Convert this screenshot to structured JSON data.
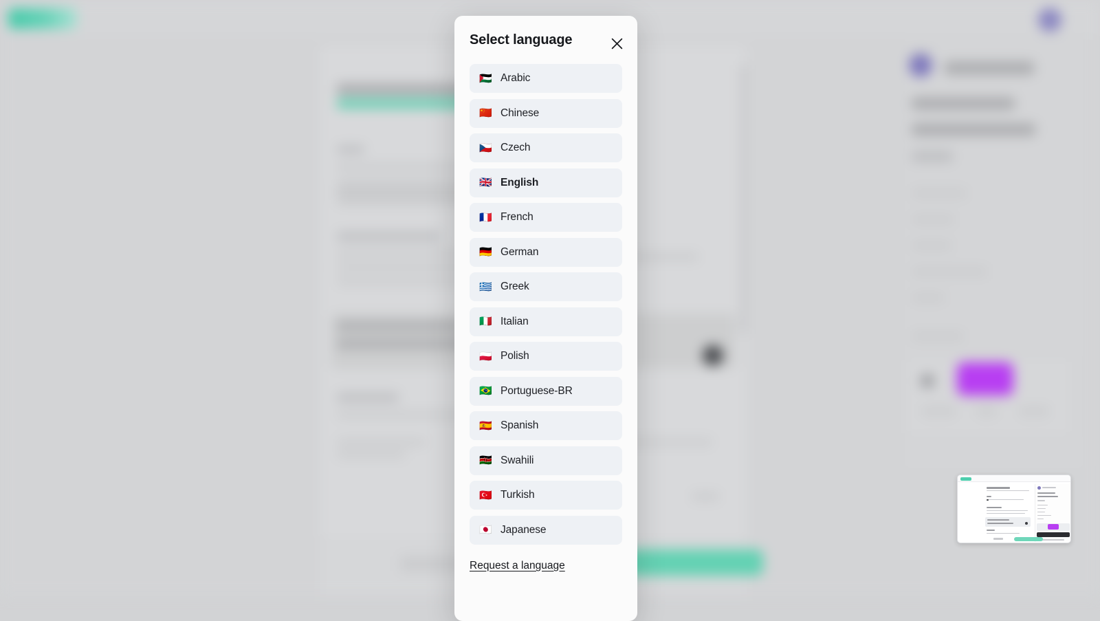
{
  "modal": {
    "title": "Select language",
    "close_icon": "close-icon",
    "request_link": "Request a language",
    "languages": [
      {
        "name": "Arabic",
        "flag": "🇵🇸",
        "selected": false
      },
      {
        "name": "Chinese",
        "flag": "🇨🇳",
        "selected": false
      },
      {
        "name": "Czech",
        "flag": "🇨🇿",
        "selected": false
      },
      {
        "name": "English",
        "flag": "🇬🇧",
        "selected": true
      },
      {
        "name": "French",
        "flag": "🇫🇷",
        "selected": false
      },
      {
        "name": "German",
        "flag": "🇩🇪",
        "selected": false
      },
      {
        "name": "Greek",
        "flag": "🇬🇷",
        "selected": false
      },
      {
        "name": "Italian",
        "flag": "🇮🇹",
        "selected": false
      },
      {
        "name": "Polish",
        "flag": "🇵🇱",
        "selected": false
      },
      {
        "name": "Portuguese-BR",
        "flag": "🇧🇷",
        "selected": false
      },
      {
        "name": "Spanish",
        "flag": "🇪🇸",
        "selected": false
      },
      {
        "name": "Swahili",
        "flag": "🇰🇪",
        "selected": false
      },
      {
        "name": "Turkish",
        "flag": "🇹🇷",
        "selected": false
      },
      {
        "name": "Japanese",
        "flag": "🇯🇵",
        "selected": false
      }
    ]
  },
  "background": {
    "description": "Blurred application page behind the modal",
    "logo_color": "#3cc9a6",
    "avatar_color": "#8b87c2",
    "accent_color": "#63d2b3",
    "highlight_color": "#b83ef2"
  },
  "thumbnail": {
    "description": "Page preview thumbnail, bottom right"
  }
}
